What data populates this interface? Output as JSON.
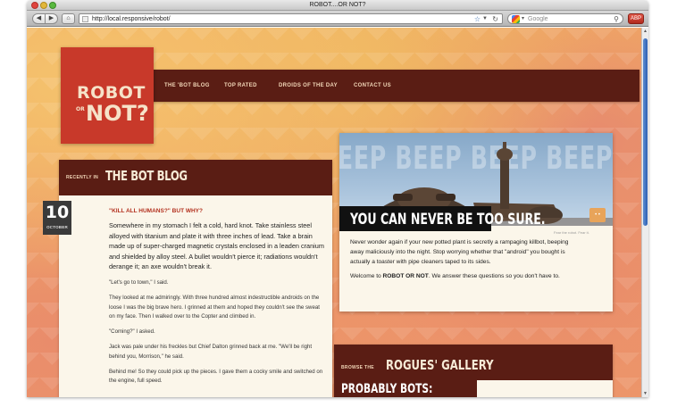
{
  "window": {
    "title": "ROBOT....OR NOT?"
  },
  "toolbar": {
    "back_glyph": "◀",
    "forward_glyph": "▶",
    "home_glyph": "⌂",
    "url": "http://local.responsive/robot/",
    "search_placeholder": "Google",
    "addon_glyph": "ABP"
  },
  "site": {
    "logo": {
      "line1": "ROBOT",
      "or": "OR",
      "line2": "NOT?"
    },
    "nav": [
      {
        "label": "THE 'BOT BLOG"
      },
      {
        "label": "TOP RATED"
      },
      {
        "label": "DROIDS OF THE DAY"
      },
      {
        "label": "CONTACT US"
      }
    ]
  },
  "blog": {
    "kicker": "RECENTLY IN",
    "title": "THE BOT BLOG",
    "date": {
      "day": "10",
      "month": "OCTOBER"
    },
    "post": {
      "title": "\"KILL ALL HUMANS?\" BUT WHY?",
      "lead": "Somewhere in my stomach I felt a cold, hard knot. Take stainless steel alloyed with titanium and plate it with three inches of lead. Take a brain made up of super-charged magnetic crystals enclosed in a leaden cranium and shielded by alloy steel. A bullet wouldn't pierce it; radiations wouldn't derange it; an axe wouldn't break it.",
      "paragraphs": [
        "\"Let's go to town,\" I said.",
        "They looked at me admiringly. With three hundred almost indestructible androids on the loose I was the big brave hero. I grinned at them and hoped they couldn't see the sweat on my face. Then I walked over to the Copter and climbed in.",
        "\"Coming?\" I asked.",
        "Jack was pale under his freckles but Chief Dalton grinned back at me. \"We'll be right behind you, Morrison,\" he said.",
        "Behind me! So they could pick up the pieces. I gave them a cocky smile and switched on the engine, full speed."
      ]
    }
  },
  "hero": {
    "background_text": "BEEP BEEP BEEP BEEP",
    "caption": "YOU CAN NEVER BE TOO SURE.",
    "credit": "Fear the robot. Fear it.",
    "body1": "Never wonder again if your new potted plant is secretly a rampaging killbot, beeping away maliciously into the night. Stop worrying whether that \"android\" you bought is actually a toaster with pipe cleaners taped to its sides.",
    "body2_pre": "Welcome to ",
    "body2_bold": "ROBOT OR NOT",
    "body2_post": ". We answer these questions so you don't have to."
  },
  "rogues": {
    "kicker": "BROWSE THE",
    "title": "ROGUES' GALLERY",
    "subheading": "PROBABLY BOTS:"
  },
  "colors": {
    "maroon": "#5a1d14",
    "logo_red": "#c8392a",
    "accent_red": "#b3311f",
    "cream": "#fbf6ea",
    "share_orange": "#e8a45a"
  }
}
